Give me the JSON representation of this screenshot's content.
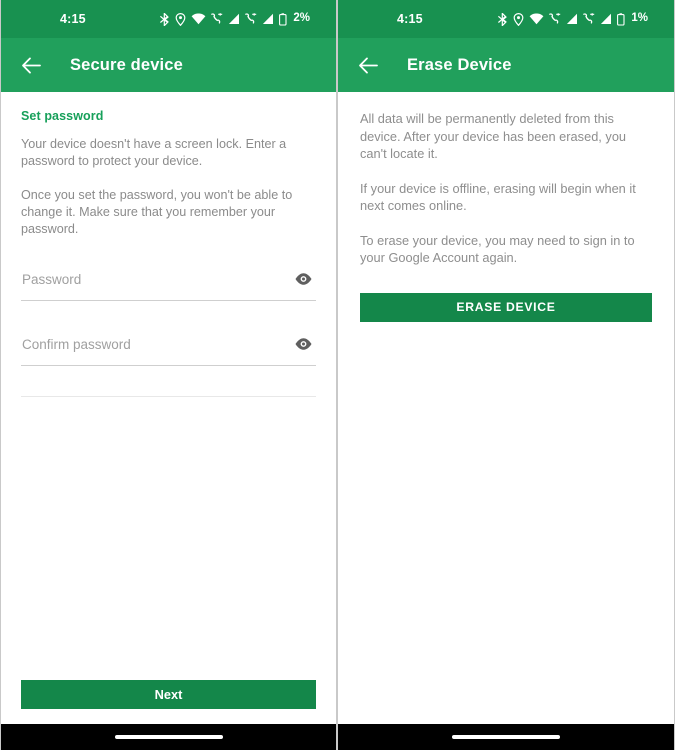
{
  "left_panel": {
    "status_bar": {
      "clock": "4:15",
      "battery_percent": "2%",
      "icons": [
        "bluetooth-icon",
        "location-icon",
        "wifi-icon",
        "call-signal-icon",
        "cellular-signal-icon",
        "call-signal-icon-2",
        "cellular-signal-icon-2",
        "battery-icon"
      ]
    },
    "app_bar": {
      "back_icon": "arrow-left-icon",
      "title": "Secure device"
    },
    "section_heading": "Set password",
    "paragraph_1": "Your device doesn't have a screen lock. Enter a password to protect your device.",
    "paragraph_2": "Once you set the password, you won't be able to change it. Make sure that you remember your password.",
    "password_field": {
      "placeholder": "Password",
      "value": "",
      "toggle_icon": "eye-icon"
    },
    "confirm_field": {
      "placeholder": "Confirm password",
      "value": "",
      "toggle_icon": "eye-icon"
    },
    "next_button": "Next"
  },
  "right_panel": {
    "status_bar": {
      "clock": "4:15",
      "battery_percent": "1%",
      "icons": [
        "bluetooth-icon",
        "location-icon",
        "wifi-icon",
        "call-signal-icon",
        "cellular-signal-icon",
        "call-signal-icon-2",
        "cellular-signal-icon-2",
        "battery-icon"
      ]
    },
    "app_bar": {
      "back_icon": "arrow-left-icon",
      "title": "Erase Device"
    },
    "paragraph_1": "All data will be permanently deleted from this device. After your device has been erased, you can't locate it.",
    "paragraph_2": "If your device is offline, erasing will begin when it next comes online.",
    "paragraph_3": "To erase your device, you may need to sign in to your Google Account again.",
    "erase_button": "ERASE DEVICE"
  },
  "colors": {
    "status_bar_green": "#189150",
    "app_bar_green": "#21a05c",
    "button_green": "#14874a",
    "heading_green": "#17a05a",
    "body_text_gray": "#8b8b8b",
    "nav_bar_black": "#000000"
  }
}
